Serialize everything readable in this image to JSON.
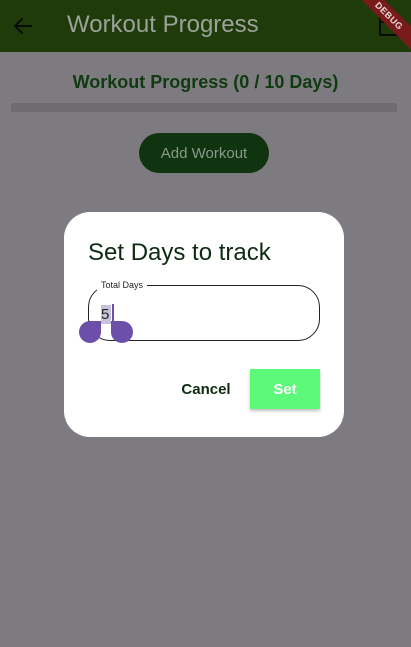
{
  "appbar": {
    "title": "Workout Progress",
    "back_icon": "arrow-left-icon",
    "action_icon": "calendar-icon",
    "debug_banner": "DEBUG",
    "background_color": "#1f3b0a"
  },
  "progress": {
    "title": "Workout Progress (0 / 10 Days)",
    "completed_days": 0,
    "total_days": 10,
    "fraction": 0
  },
  "add_workout": {
    "label": "Add Workout"
  },
  "dialog": {
    "title": "Set Days to track",
    "field": {
      "label": "Total Days",
      "value": "5"
    },
    "cancel_label": "Cancel",
    "set_label": "Set",
    "set_button_color": "#5dfa7a",
    "selection_handle_color": "#6b4fa8"
  }
}
